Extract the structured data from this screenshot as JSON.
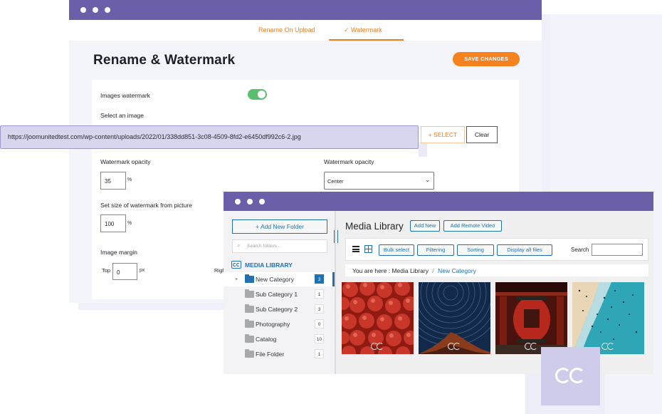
{
  "window1": {
    "tabs": [
      {
        "label": "Rename On Upload"
      },
      {
        "label": "✓  Watermark"
      }
    ],
    "title": "Rename & Watermark",
    "save_label": "SAVE CHANGES",
    "images_watermark_label": "Images watermark",
    "images_watermark_on": true,
    "select_image_label": "Select an image",
    "url_value": "https://joomunitedtest.com/wp-content/uploads/2022/01/338dd851-3c08-4509-8fd2-e6450df992c6-2.jpg",
    "select_button": "+ SELECT",
    "clear_button": "Clear",
    "opacity_label": "Watermark opacity",
    "opacity_value": "35",
    "opacity_unit": "%",
    "position_label": "Watermark opacity",
    "position_value": "Center",
    "size_label": "Set size of watermark from picture",
    "size_value": "100",
    "size_unit": "%",
    "margin_label": "Image margin",
    "margin_top_label": "Top",
    "margin_top_value": "0",
    "margin_top_unit": "px",
    "margin_right_label": "Righ"
  },
  "window2": {
    "add_folder": "+ Add New Folder",
    "search_placeholder": "Search folders...",
    "library_heading": "MEDIA LIBRARY",
    "folders": [
      {
        "name": "New Category",
        "count": "3",
        "active": true
      },
      {
        "name": "Sub Category 1",
        "count": "1"
      },
      {
        "name": "Sub Category 2",
        "count": "3"
      },
      {
        "name": "Photography",
        "count": "0"
      },
      {
        "name": "Catalog",
        "count": "10"
      },
      {
        "name": "File Folder",
        "count": "1"
      }
    ],
    "main_title": "Media Library",
    "add_new": "Add New",
    "add_remote_video": "Add Remote Video",
    "toolbar": {
      "bulk_select": "Bulk select",
      "filtering": "Filtering",
      "sorting": "Sorting",
      "display_all": "Display all files",
      "search_label": "Search"
    },
    "breadcrumb": {
      "prefix": "You are here  :  Media Library",
      "separator": "/",
      "current": "New Category"
    },
    "images": [
      "apples-photo",
      "star-trails-mountain-photo",
      "temple-lantern-photo",
      "beach-aerial-photo"
    ]
  },
  "colors": {
    "titlebar": "#6c5fa9",
    "accent_orange": "#f5811f",
    "wp_blue": "#2271b1",
    "toggle_green": "#5cbf6e"
  }
}
